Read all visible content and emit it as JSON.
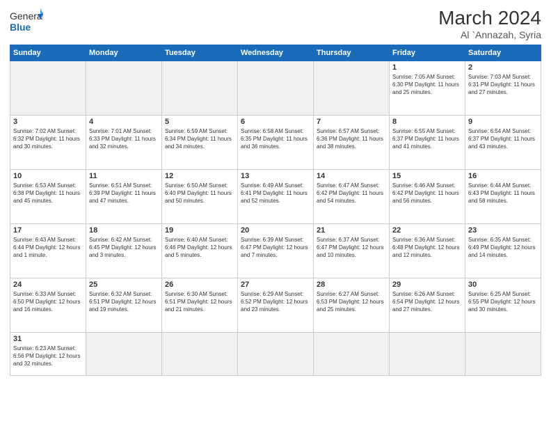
{
  "logo": {
    "text_general": "General",
    "text_blue": "Blue"
  },
  "title": "March 2024",
  "subtitle": "Al `Annazah, Syria",
  "weekdays": [
    "Sunday",
    "Monday",
    "Tuesday",
    "Wednesday",
    "Thursday",
    "Friday",
    "Saturday"
  ],
  "weeks": [
    [
      {
        "day": "",
        "info": ""
      },
      {
        "day": "",
        "info": ""
      },
      {
        "day": "",
        "info": ""
      },
      {
        "day": "",
        "info": ""
      },
      {
        "day": "",
        "info": ""
      },
      {
        "day": "1",
        "info": "Sunrise: 7:05 AM\nSunset: 6:30 PM\nDaylight: 11 hours and 25 minutes."
      },
      {
        "day": "2",
        "info": "Sunrise: 7:03 AM\nSunset: 6:31 PM\nDaylight: 11 hours and 27 minutes."
      }
    ],
    [
      {
        "day": "3",
        "info": "Sunrise: 7:02 AM\nSunset: 6:32 PM\nDaylight: 11 hours and 30 minutes."
      },
      {
        "day": "4",
        "info": "Sunrise: 7:01 AM\nSunset: 6:33 PM\nDaylight: 11 hours and 32 minutes."
      },
      {
        "day": "5",
        "info": "Sunrise: 6:59 AM\nSunset: 6:34 PM\nDaylight: 11 hours and 34 minutes."
      },
      {
        "day": "6",
        "info": "Sunrise: 6:58 AM\nSunset: 6:35 PM\nDaylight: 11 hours and 36 minutes."
      },
      {
        "day": "7",
        "info": "Sunrise: 6:57 AM\nSunset: 6:36 PM\nDaylight: 11 hours and 38 minutes."
      },
      {
        "day": "8",
        "info": "Sunrise: 6:55 AM\nSunset: 6:37 PM\nDaylight: 11 hours and 41 minutes."
      },
      {
        "day": "9",
        "info": "Sunrise: 6:54 AM\nSunset: 6:37 PM\nDaylight: 11 hours and 43 minutes."
      }
    ],
    [
      {
        "day": "10",
        "info": "Sunrise: 6:53 AM\nSunset: 6:38 PM\nDaylight: 11 hours and 45 minutes."
      },
      {
        "day": "11",
        "info": "Sunrise: 6:51 AM\nSunset: 6:39 PM\nDaylight: 11 hours and 47 minutes."
      },
      {
        "day": "12",
        "info": "Sunrise: 6:50 AM\nSunset: 6:40 PM\nDaylight: 11 hours and 50 minutes."
      },
      {
        "day": "13",
        "info": "Sunrise: 6:49 AM\nSunset: 6:41 PM\nDaylight: 11 hours and 52 minutes."
      },
      {
        "day": "14",
        "info": "Sunrise: 6:47 AM\nSunset: 6:42 PM\nDaylight: 11 hours and 54 minutes."
      },
      {
        "day": "15",
        "info": "Sunrise: 6:46 AM\nSunset: 6:42 PM\nDaylight: 11 hours and 56 minutes."
      },
      {
        "day": "16",
        "info": "Sunrise: 6:44 AM\nSunset: 6:43 PM\nDaylight: 11 hours and 58 minutes."
      }
    ],
    [
      {
        "day": "17",
        "info": "Sunrise: 6:43 AM\nSunset: 6:44 PM\nDaylight: 12 hours and 1 minute."
      },
      {
        "day": "18",
        "info": "Sunrise: 6:42 AM\nSunset: 6:45 PM\nDaylight: 12 hours and 3 minutes."
      },
      {
        "day": "19",
        "info": "Sunrise: 6:40 AM\nSunset: 6:46 PM\nDaylight: 12 hours and 5 minutes."
      },
      {
        "day": "20",
        "info": "Sunrise: 6:39 AM\nSunset: 6:47 PM\nDaylight: 12 hours and 7 minutes."
      },
      {
        "day": "21",
        "info": "Sunrise: 6:37 AM\nSunset: 6:47 PM\nDaylight: 12 hours and 10 minutes."
      },
      {
        "day": "22",
        "info": "Sunrise: 6:36 AM\nSunset: 6:48 PM\nDaylight: 12 hours and 12 minutes."
      },
      {
        "day": "23",
        "info": "Sunrise: 6:35 AM\nSunset: 6:49 PM\nDaylight: 12 hours and 14 minutes."
      }
    ],
    [
      {
        "day": "24",
        "info": "Sunrise: 6:33 AM\nSunset: 6:50 PM\nDaylight: 12 hours and 16 minutes."
      },
      {
        "day": "25",
        "info": "Sunrise: 6:32 AM\nSunset: 6:51 PM\nDaylight: 12 hours and 19 minutes."
      },
      {
        "day": "26",
        "info": "Sunrise: 6:30 AM\nSunset: 6:51 PM\nDaylight: 12 hours and 21 minutes."
      },
      {
        "day": "27",
        "info": "Sunrise: 6:29 AM\nSunset: 6:52 PM\nDaylight: 12 hours and 23 minutes."
      },
      {
        "day": "28",
        "info": "Sunrise: 6:27 AM\nSunset: 6:53 PM\nDaylight: 12 hours and 25 minutes."
      },
      {
        "day": "29",
        "info": "Sunrise: 6:26 AM\nSunset: 6:54 PM\nDaylight: 12 hours and 27 minutes."
      },
      {
        "day": "30",
        "info": "Sunrise: 6:25 AM\nSunset: 6:55 PM\nDaylight: 12 hours and 30 minutes."
      }
    ],
    [
      {
        "day": "31",
        "info": "Sunrise: 6:23 AM\nSunset: 6:56 PM\nDaylight: 12 hours and 32 minutes."
      },
      {
        "day": "",
        "info": ""
      },
      {
        "day": "",
        "info": ""
      },
      {
        "day": "",
        "info": ""
      },
      {
        "day": "",
        "info": ""
      },
      {
        "day": "",
        "info": ""
      },
      {
        "day": "",
        "info": ""
      }
    ]
  ]
}
